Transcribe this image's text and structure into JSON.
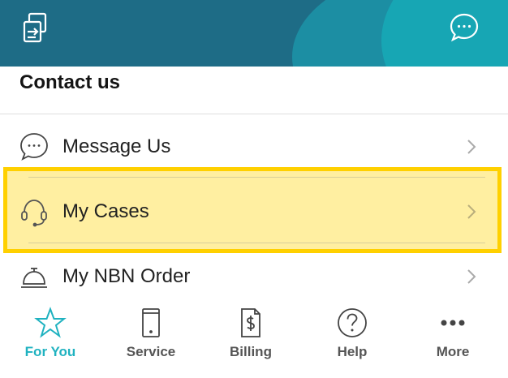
{
  "header": {
    "left_icon": "switch-account-icon",
    "right_icon": "chat-bubble-icon"
  },
  "contact": {
    "title": "Contact us",
    "items": [
      {
        "label": "Message Us",
        "icon": "chat-bubble-icon"
      },
      {
        "label": "My Cases",
        "icon": "headset-icon"
      },
      {
        "label": "My NBN Order",
        "icon": "service-bell-icon"
      }
    ]
  },
  "tabs": [
    {
      "label": "For You",
      "icon": "star-icon",
      "active": true
    },
    {
      "label": "Service",
      "icon": "device-icon",
      "active": false
    },
    {
      "label": "Billing",
      "icon": "bill-icon",
      "active": false
    },
    {
      "label": "Help",
      "icon": "help-icon",
      "active": false
    },
    {
      "label": "More",
      "icon": "more-icon",
      "active": false
    }
  ],
  "colors": {
    "header_dark": "#1e6c86",
    "header_light": "#17a6b4",
    "accent": "#1fb2c0",
    "highlight_border": "#ffd000"
  }
}
